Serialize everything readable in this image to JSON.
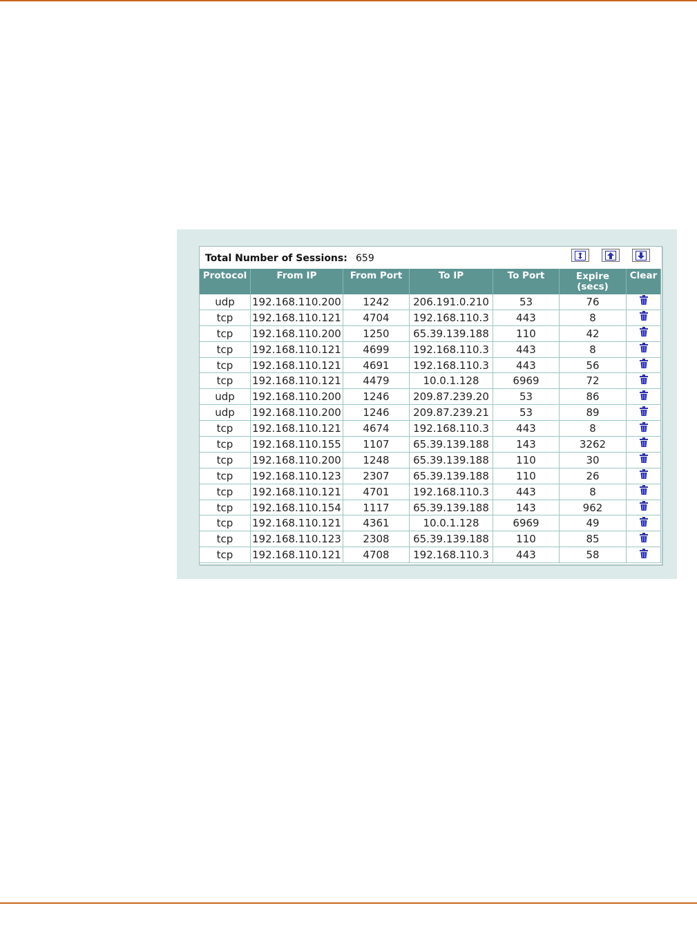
{
  "session_list": {
    "total_label": "Total Number of Sessions:",
    "total_value": "659",
    "buttons": [
      {
        "name": "refresh-button",
        "icon": "refresh-icon"
      },
      {
        "name": "page-up-button",
        "icon": "page-up-icon"
      },
      {
        "name": "page-down-button",
        "icon": "page-down-icon"
      }
    ],
    "columns": [
      "Protocol",
      "From IP",
      "From Port",
      "To IP",
      "To Port",
      "Expire",
      "(secs)",
      "Clear"
    ],
    "rows": [
      [
        "udp",
        "192.168.110.200",
        "1242",
        "206.191.0.210",
        "53",
        "76"
      ],
      [
        "tcp",
        "192.168.110.121",
        "4704",
        "192.168.110.3",
        "443",
        "8"
      ],
      [
        "tcp",
        "192.168.110.200",
        "1250",
        "65.39.139.188",
        "110",
        "42"
      ],
      [
        "tcp",
        "192.168.110.121",
        "4699",
        "192.168.110.3",
        "443",
        "8"
      ],
      [
        "tcp",
        "192.168.110.121",
        "4691",
        "192.168.110.3",
        "443",
        "56"
      ],
      [
        "tcp",
        "192.168.110.121",
        "4479",
        "10.0.1.128",
        "6969",
        "72"
      ],
      [
        "udp",
        "192.168.110.200",
        "1246",
        "209.87.239.20",
        "53",
        "86"
      ],
      [
        "udp",
        "192.168.110.200",
        "1246",
        "209.87.239.21",
        "53",
        "89"
      ],
      [
        "tcp",
        "192.168.110.121",
        "4674",
        "192.168.110.3",
        "443",
        "8"
      ],
      [
        "tcp",
        "192.168.110.155",
        "1107",
        "65.39.139.188",
        "143",
        "3262"
      ],
      [
        "tcp",
        "192.168.110.200",
        "1248",
        "65.39.139.188",
        "110",
        "30"
      ],
      [
        "tcp",
        "192.168.110.123",
        "2307",
        "65.39.139.188",
        "110",
        "26"
      ],
      [
        "tcp",
        "192.168.110.121",
        "4701",
        "192.168.110.3",
        "443",
        "8"
      ],
      [
        "tcp",
        "192.168.110.154",
        "1117",
        "65.39.139.188",
        "143",
        "962"
      ],
      [
        "tcp",
        "192.168.110.121",
        "4361",
        "10.0.1.128",
        "6969",
        "49"
      ],
      [
        "tcp",
        "192.168.110.123",
        "2308",
        "65.39.139.188",
        "110",
        "85"
      ],
      [
        "tcp",
        "192.168.110.121",
        "4708",
        "192.168.110.3",
        "443",
        "58"
      ]
    ],
    "clear_icon": "trash-icon"
  },
  "colors": {
    "rule": "#c8661c",
    "panel_bg": "#dcebea",
    "header_bg": "#5d9593",
    "icon_blue": "#2a2fb0"
  }
}
